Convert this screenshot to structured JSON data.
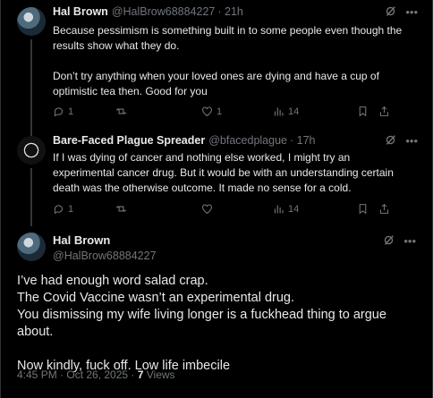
{
  "tweet1": {
    "name": "Hal Brown",
    "handle": "@HalBrow68884227",
    "time": "· 21h",
    "text_lines": [
      "Because pessimism is something built in to some people even though the",
      "results show what they do.",
      "",
      "Don’t try anything when your loved ones are dying and have a cup of",
      "optimistic tea then. Good for you"
    ],
    "replies": "1",
    "likes": "1",
    "views": "14"
  },
  "tweet2": {
    "name": "Bare-Faced Plague Spreader",
    "handle": "@bfacedplague",
    "time": "· 17h",
    "text_lines": [
      "If I was dying of cancer and nothing else worked, I might try an",
      "experimental cancer drug. But it would be with an understanding certain",
      "death was the otherwise outcome. It made no sense for a cold."
    ],
    "replies": "1",
    "views": "14"
  },
  "main": {
    "name": "Hal Brown",
    "handle": "@HalBrow68884227",
    "text_lines": [
      "I’ve had enough word salad crap.",
      "The Covid Vaccine wasn’t an experimental drug.",
      "You dismissing my wife living longer is a fuckhead thing to argue about.",
      "",
      "Now kindly, fuck off. Low life imbecile"
    ],
    "timestamp": "4:45 PM · Oct 26, 2025 · ",
    "views_count": "7",
    "views_label": " Views"
  },
  "icons": {
    "more": "more-icon",
    "grok": "grok-icon",
    "reply": "reply-icon",
    "repost": "repost-icon",
    "like": "like-icon",
    "analytics": "analytics-icon",
    "bookmark": "bookmark-icon",
    "share": "share-icon"
  },
  "colors": {
    "background": "#000000",
    "text": "#e7e9ea",
    "muted": "#71767b",
    "divider": "#2f3336"
  }
}
